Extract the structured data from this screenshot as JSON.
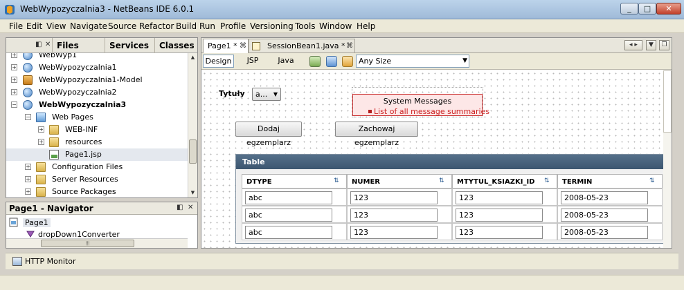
{
  "window": {
    "title": "WebWypozyczalnia3 - NetBeans IDE 6.0.1",
    "min": "_",
    "max": "□",
    "close": "✕"
  },
  "menu": [
    "File",
    "Edit",
    "View",
    "Navigate",
    "Source",
    "Refactor",
    "Build",
    "Run",
    "Profile",
    "Versioning",
    "Tools",
    "Window",
    "Help"
  ],
  "projects_panel": {
    "tabs": [
      "Files",
      "Services",
      "Classes"
    ],
    "controls": [
      "◧",
      "✕"
    ],
    "tree": [
      {
        "label": "WebWyp1",
        "icon": "globe-icon"
      },
      {
        "label": "WebWypozyczalnia1",
        "icon": "globe-icon"
      },
      {
        "label": "WebWypozyczalnia1-Model",
        "icon": "model-icon"
      },
      {
        "label": "WebWypozyczalnia2",
        "icon": "globe-icon"
      },
      {
        "label": "WebWypozyczalnia3",
        "icon": "globe-icon"
      },
      {
        "label": "Web Pages",
        "icon": "web-folder-icon"
      },
      {
        "label": "WEB-INF",
        "icon": "folder-icon"
      },
      {
        "label": "resources",
        "icon": "folder-icon"
      },
      {
        "label": "Page1.jsp",
        "icon": "jsp-file-icon"
      },
      {
        "label": "Configuration Files",
        "icon": "folder-icon"
      },
      {
        "label": "Server Resources",
        "icon": "folder-icon"
      },
      {
        "label": "Source Packages",
        "icon": "folder-icon"
      }
    ]
  },
  "navigator": {
    "title": "Page1 - Navigator",
    "controls": [
      "◧",
      "✕"
    ],
    "items": [
      "Page1",
      "dropDown1Converter"
    ]
  },
  "editor": {
    "tabs": [
      {
        "label": "Page1 *",
        "close": "⌘"
      },
      {
        "label": "SessionBean1.java *",
        "close": "⌘"
      }
    ],
    "views": [
      "Design",
      "JSP",
      "Java"
    ],
    "size_option": "Any Size",
    "canvas": {
      "label": "Tytuły",
      "dropdown_value": "a...",
      "messages_title": "System Messages",
      "messages_item": "List of all message summaries",
      "add_button": "Dodaj egzemplarz",
      "save_button": "Zachowaj egzemplarz",
      "table": {
        "caption": "Table",
        "columns": [
          "DTYPE",
          "NUMER",
          "MTYTUL_KSIAZKI_ID",
          "TERMIN"
        ],
        "rows": [
          [
            "abc",
            "123",
            "123",
            "2008-05-23"
          ],
          [
            "abc",
            "123",
            "123",
            "2008-05-23"
          ],
          [
            "abc",
            "123",
            "123",
            "2008-05-23"
          ]
        ]
      }
    }
  },
  "bottom": {
    "http_monitor": "HTTP Monitor"
  },
  "colors": {
    "table_caption": "#4a657f",
    "message_border": "#cc3333",
    "title_bar": "#a8c2de"
  }
}
